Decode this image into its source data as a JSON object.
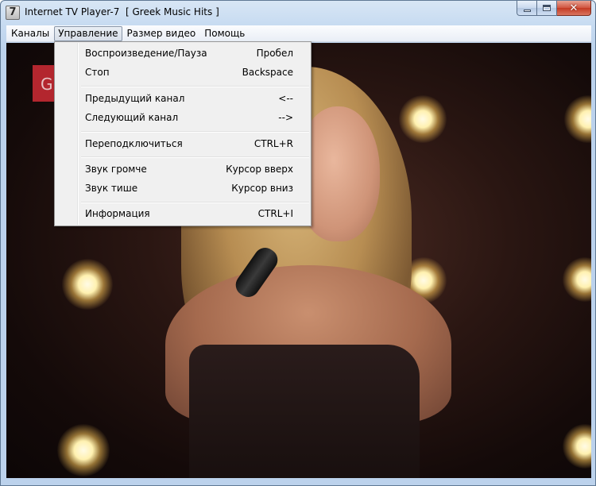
{
  "window": {
    "title": "Internet TV Player-7  [ Greek Music Hits ]",
    "app_icon_text": "7",
    "controls": {
      "minimize_icon": "minimize-icon",
      "maximize_icon": "maximize-icon",
      "close_icon": "close-icon",
      "close_symbol": "✕"
    }
  },
  "menubar": {
    "items": [
      {
        "label": "Каналы"
      },
      {
        "label": "Управление"
      },
      {
        "label": "Размер видео"
      },
      {
        "label": "Помощь"
      }
    ],
    "active_index": 1
  },
  "dropdown": {
    "groups": [
      [
        {
          "label": "Воспроизведение/Пауза",
          "shortcut": "Пробел"
        },
        {
          "label": "Стоп",
          "shortcut": "Backspace"
        }
      ],
      [
        {
          "label": "Предыдущий канал",
          "shortcut": "<--"
        },
        {
          "label": "Следующий канал",
          "shortcut": "-->"
        }
      ],
      [
        {
          "label": "Переподключиться",
          "shortcut": "CTRL+R"
        }
      ],
      [
        {
          "label": "Звук громче",
          "shortcut": "Курсор вверх"
        },
        {
          "label": "Звук тише",
          "shortcut": "Курсор вниз"
        }
      ],
      [
        {
          "label": "Информация",
          "shortcut": "CTRL+I"
        }
      ]
    ]
  },
  "video": {
    "channel_logo_letter": "G"
  },
  "colors": {
    "title_gradient_top": "#d8e6f5",
    "close_button_red": "#c43a23",
    "menu_background": "#f0f0f0",
    "logo_red": "#b3262e"
  }
}
